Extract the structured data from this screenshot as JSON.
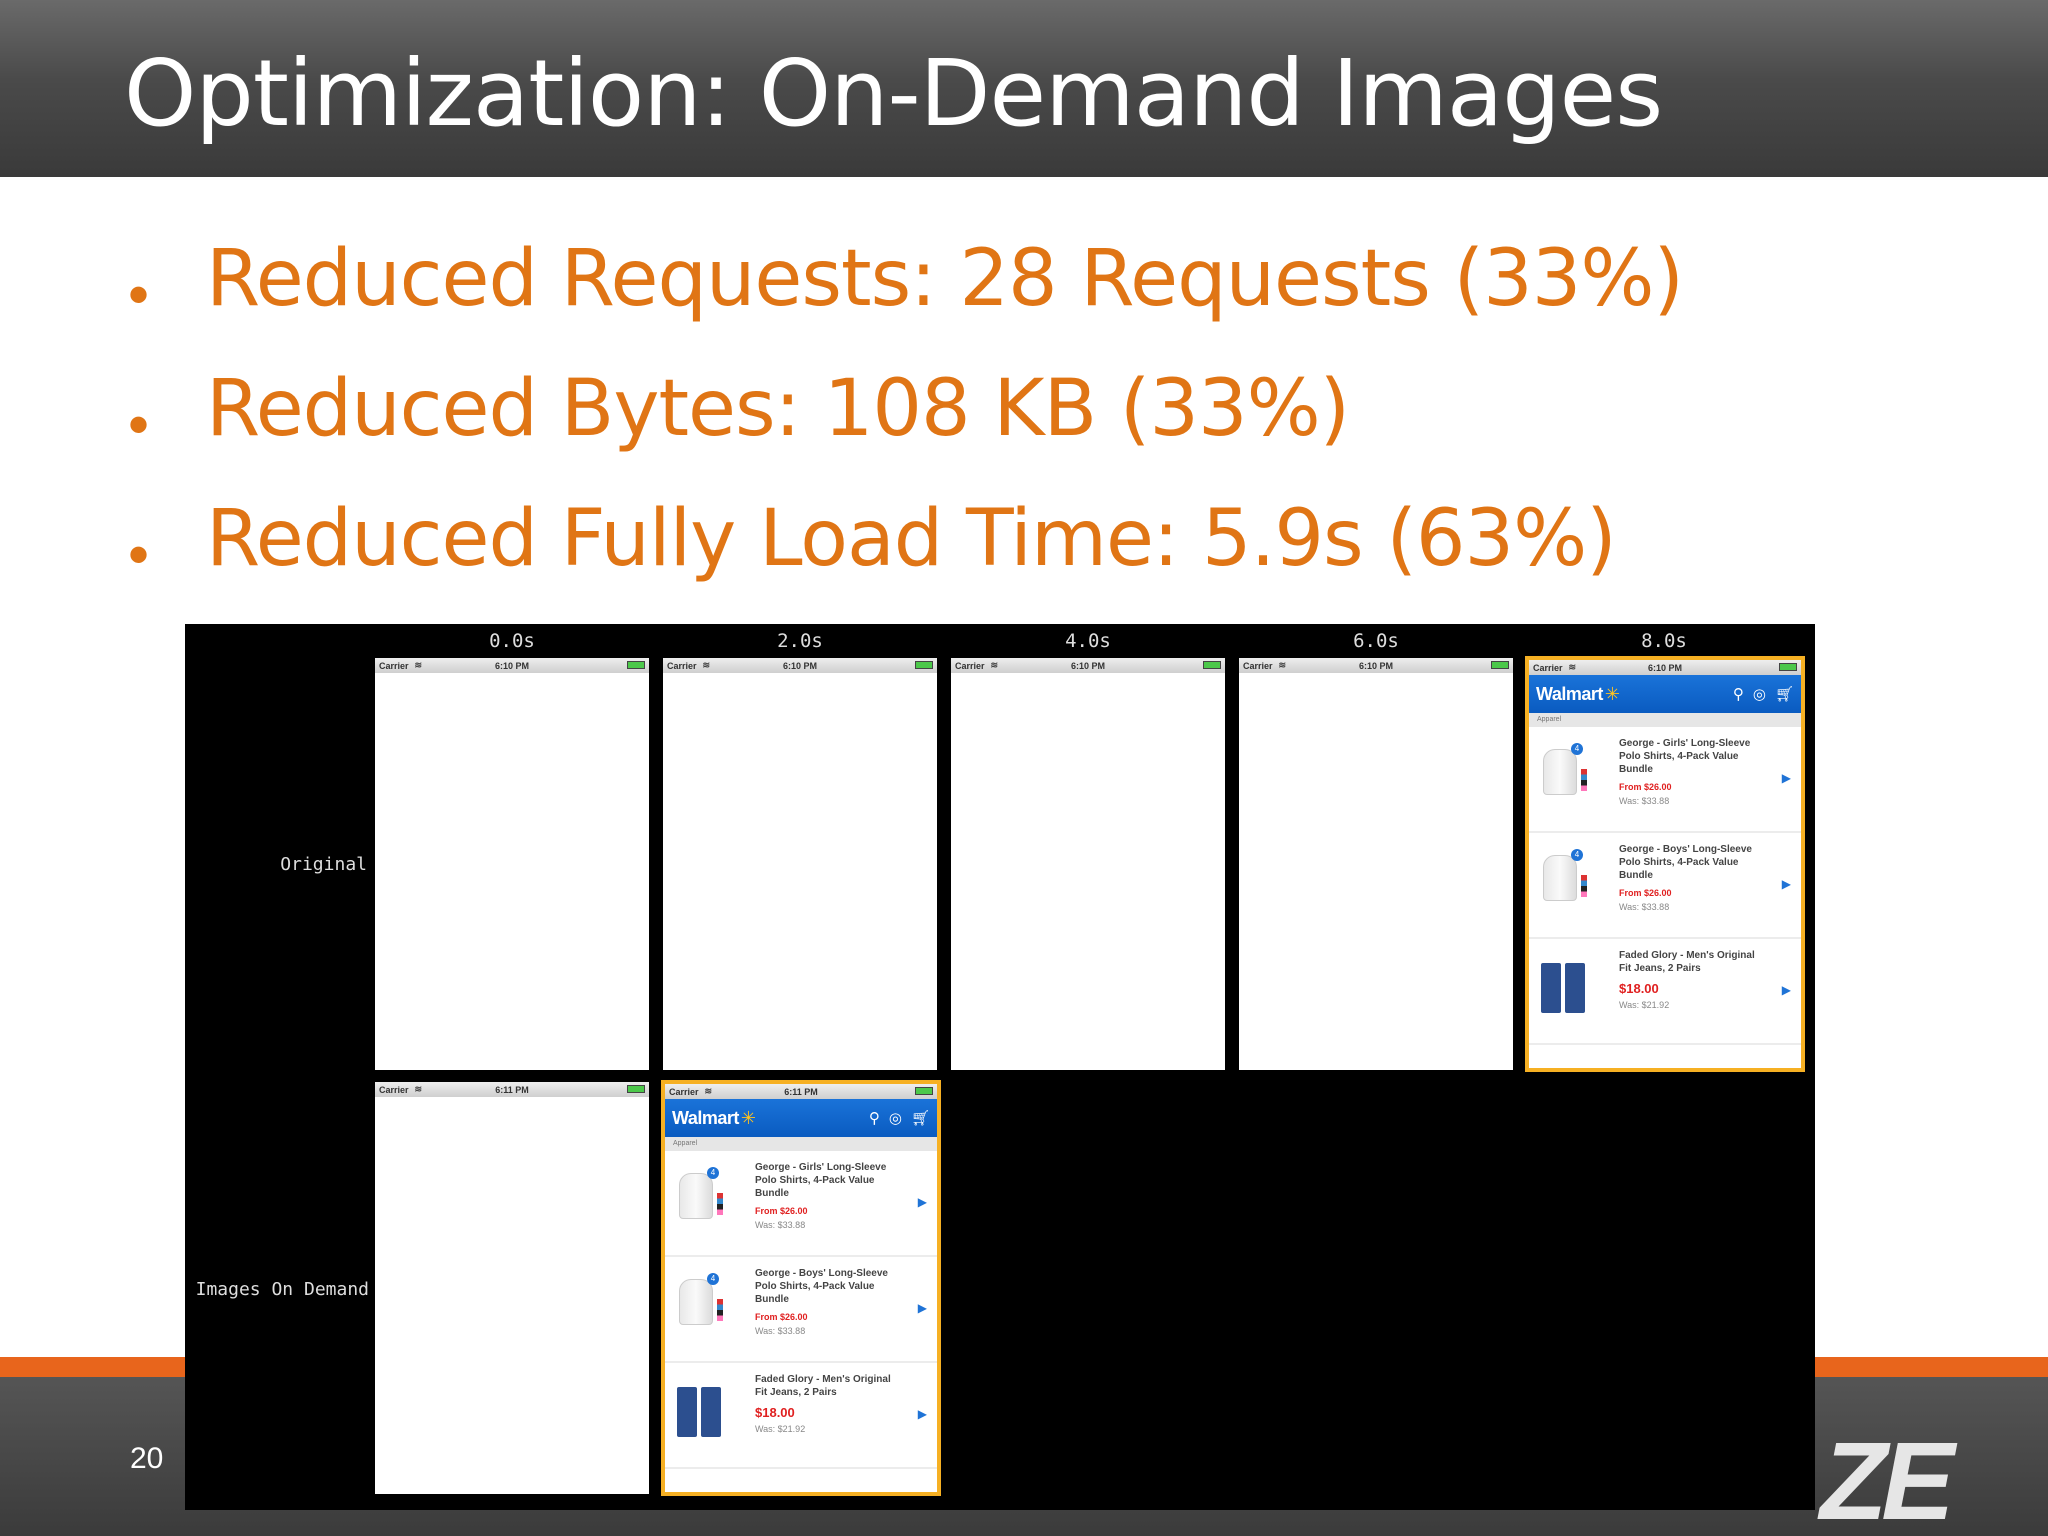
{
  "slide": {
    "title": "Optimization: On-Demand Images",
    "bullets": [
      "Reduced Requests: 28 Requests (33%)",
      "Reduced Bytes: 108 KB (33%)",
      "Reduced Fully Load Time: 5.9s (63%)"
    ],
    "page_number": "20",
    "logo_fragment": "ZE"
  },
  "filmstrip": {
    "times": [
      "0.0s",
      "2.0s",
      "4.0s",
      "6.0s",
      "8.0s"
    ],
    "rows": [
      "Original",
      "Images On Demand"
    ]
  },
  "phone": {
    "carrier": "Carrier",
    "time_original": "6:10 PM",
    "time_ondemand": "6:11 PM",
    "brand": "Walmart",
    "breadcrumb": "Apparel",
    "products": [
      {
        "name": "George - Girls' Long-Sleeve Polo Shirts, 4-Pack Value Bundle",
        "price": "From $26.00",
        "was": "Was: $33.88"
      },
      {
        "name": "George - Boys' Long-Sleeve Polo Shirts, 4-Pack Value Bundle",
        "price": "From $26.00",
        "was": "Was: $33.88"
      },
      {
        "name": "Faded Glory - Men's Original Fit Jeans, 2 Pairs",
        "price": "$18.00",
        "was": "Was: $21.92"
      }
    ]
  },
  "colors": {
    "accent": "#e07515",
    "highlight": "#f6b023",
    "walmart_blue": "#0a5bc0"
  }
}
